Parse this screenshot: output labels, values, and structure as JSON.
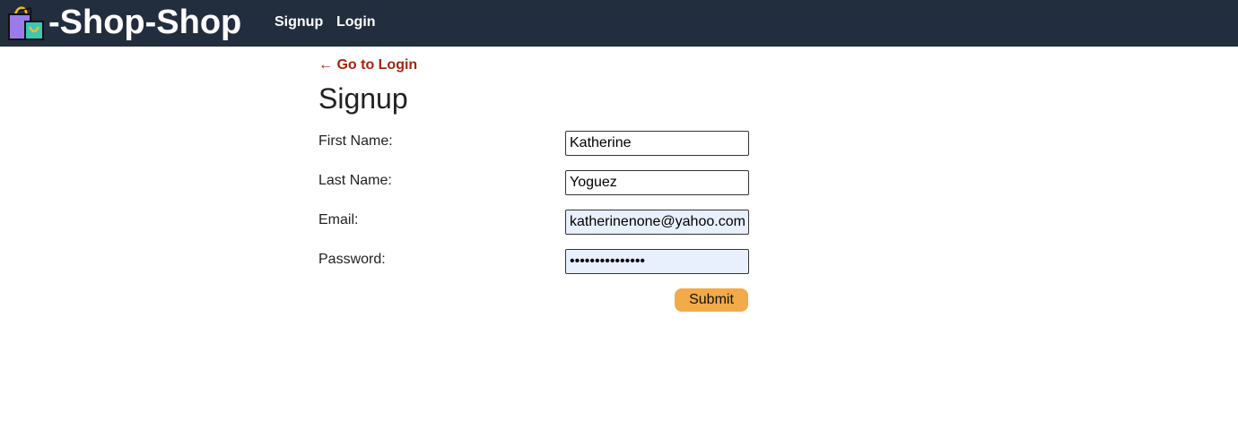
{
  "header": {
    "brand": "-Shop-Shop",
    "logo_icon": "shopping-bags-icon",
    "nav": {
      "signup_label": "Signup",
      "login_label": "Login"
    },
    "background_color": "#222e3e"
  },
  "main": {
    "back_link": "← Go to Login",
    "title": "Signup",
    "form": {
      "first_name": {
        "label": "First Name:",
        "value": "Katherine"
      },
      "last_name": {
        "label": "Last Name:",
        "value": "Yoguez"
      },
      "email": {
        "label": "Email:",
        "value": "katherinenone@yahoo.com"
      },
      "password": {
        "label": "Password:",
        "value": "•••••••••••••••"
      },
      "submit_label": "Submit"
    }
  },
  "colors": {
    "back_link": "#a8230e",
    "submit_button": "#f2ab48",
    "autofill_background": "#e8f0fe"
  }
}
